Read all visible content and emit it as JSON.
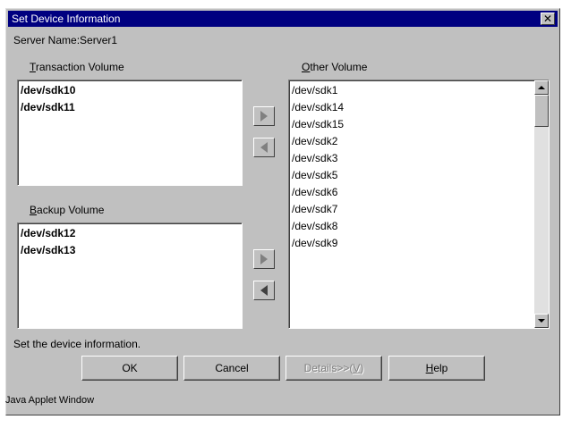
{
  "window": {
    "title": "Set Device Information",
    "close_label": "✕"
  },
  "server": {
    "label": "Server Name:Server1"
  },
  "transaction": {
    "label_mnemonic": "T",
    "label_rest": "ransaction Volume",
    "items": [
      "/dev/sdk10",
      "/dev/sdk11"
    ]
  },
  "backup": {
    "label_mnemonic": "B",
    "label_rest": "ackup Volume",
    "items": [
      "/dev/sdk12",
      "/dev/sdk13"
    ]
  },
  "other": {
    "label_mnemonic": "O",
    "label_rest": "ther Volume",
    "items": [
      "/dev/sdk1",
      "/dev/sdk14",
      "/dev/sdk15",
      "/dev/sdk2",
      "/dev/sdk3",
      "/dev/sdk5",
      "/dev/sdk6",
      "/dev/sdk7",
      "/dev/sdk8",
      "/dev/sdk9"
    ]
  },
  "message": "Set the device information.",
  "buttons": {
    "ok": "OK",
    "cancel": "Cancel",
    "details_prefix": "Details>>(",
    "details_mnemonic": "V",
    "details_suffix": ")",
    "help_mnemonic": "H",
    "help_rest": "elp"
  },
  "status_bar": "Java Applet Window",
  "icons": {
    "move_right": "triangle-right",
    "move_left": "triangle-left",
    "scroll_up": "triangle-up",
    "scroll_down": "triangle-down",
    "close": "close-icon"
  },
  "colors": {
    "titlebar": "#000080",
    "dialog": "#c0c0c0",
    "list_bg": "#ffffff"
  }
}
